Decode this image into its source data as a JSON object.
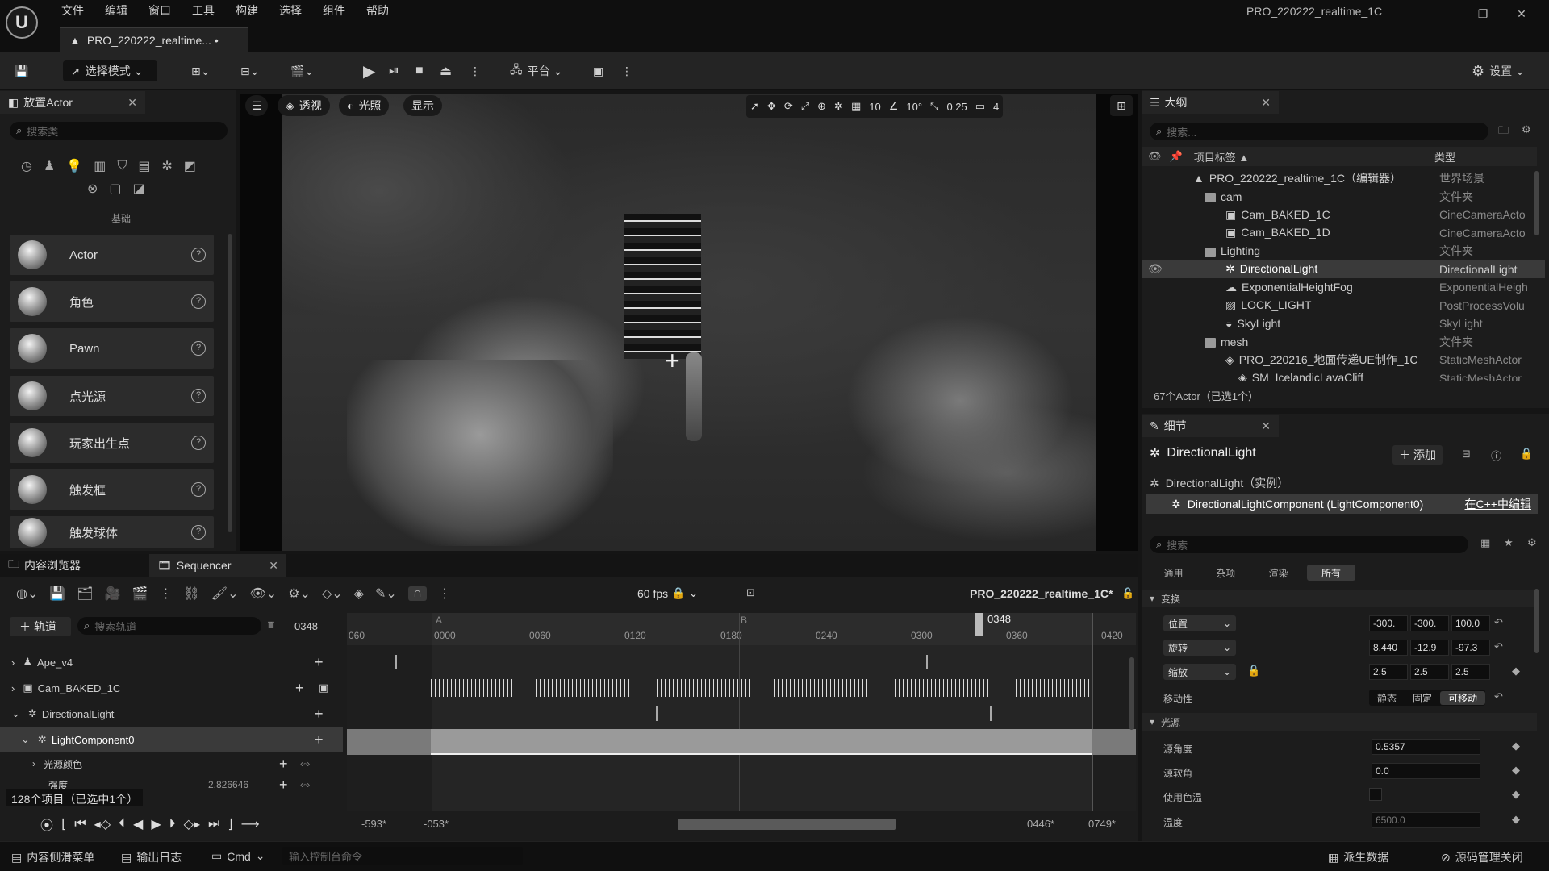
{
  "menu": [
    "文件",
    "编辑",
    "窗口",
    "工具",
    "构建",
    "选择",
    "组件",
    "帮助"
  ],
  "window_title": "PRO_220222_realtime_1C",
  "doc_tab": "PRO_220222_realtime... •",
  "toolbar": {
    "select_mode": "选择模式",
    "platform": "平台",
    "settings": "设置"
  },
  "place_actor": {
    "tab": "放置Actor",
    "search_placeholder": "搜索类",
    "category": "基础",
    "items": [
      "Actor",
      "角色",
      "Pawn",
      "点光源",
      "玩家出生点",
      "触发框",
      "触发球体"
    ]
  },
  "viewport": {
    "perspective": "透视",
    "lighting": "光照",
    "show": "显示",
    "grid": "10",
    "angle": "10°",
    "scale": "0.25",
    "camera": "4"
  },
  "outliner": {
    "tab": "大纲",
    "search_placeholder": "搜索...",
    "col_label": "项目标签 ▲",
    "col_type": "类型",
    "rows": [
      {
        "name": "PRO_220222_realtime_1C（编辑器）",
        "type": "世界场景"
      },
      {
        "name": "cam",
        "type": "文件夹"
      },
      {
        "name": "Cam_BAKED_1C",
        "type": "CineCameraActo"
      },
      {
        "name": "Cam_BAKED_1D",
        "type": "CineCameraActo"
      },
      {
        "name": "Lighting",
        "type": "文件夹"
      },
      {
        "name": "DirectionalLight",
        "type": "DirectionalLight"
      },
      {
        "name": "ExponentialHeightFog",
        "type": "ExponentialHeigh"
      },
      {
        "name": "LOCK_LIGHT",
        "type": "PostProcessVolu"
      },
      {
        "name": "SkyLight",
        "type": "SkyLight"
      },
      {
        "name": "mesh",
        "type": "文件夹"
      },
      {
        "name": "PRO_220216_地面传递UE制作_1C",
        "type": "StaticMeshActor"
      },
      {
        "name": "SM_IcelandicLavaCliff",
        "type": "StaticMeshActor"
      }
    ],
    "count": "67个Actor（已选1个）"
  },
  "details": {
    "tab": "细节",
    "title": "DirectionalLight",
    "add": "添加",
    "instance": "DirectionalLight（实例）",
    "component": "DirectionalLightComponent (LightComponent0)",
    "edit_cpp": "在C++中编辑",
    "search_placeholder": "搜索",
    "filters": [
      "通用",
      "杂项",
      "渲染",
      "所有"
    ],
    "transform": "变换",
    "location": "位置",
    "rotation": "旋转",
    "scale": "缩放",
    "loc": [
      "-300.",
      "-300.",
      "100.0"
    ],
    "rot": [
      "8.440",
      "-12.9",
      "-97.3"
    ],
    "scl": [
      "2.5",
      "2.5",
      "2.5"
    ],
    "mobility": "移动性",
    "mob_opts": [
      "静态",
      "固定",
      "可移动"
    ],
    "light": "光源",
    "source_angle": "源角度",
    "source_angle_val": "0.5357",
    "source_soft": "源软角",
    "source_soft_val": "0.0",
    "use_temp": "使用色温",
    "temp": "温度",
    "temp_val": "6500.0"
  },
  "bottom_tabs": {
    "content": "内容浏览器",
    "sequencer": "Sequencer"
  },
  "sequencer": {
    "fps": "60 fps",
    "seq_name": "PRO_220222_realtime_1C*",
    "add_track": "轨道",
    "search_placeholder": "搜索轨道",
    "frame": "0348",
    "tracks": [
      "Ape_v4",
      "Cam_BAKED_1C",
      "DirectionalLight",
      "LightComponent0",
      "光源颜色",
      "强度"
    ],
    "intensity_val": "2.826646",
    "items_count": "128个项目（已选中1个）",
    "ticks": [
      "060",
      "0000",
      "0060",
      "0120",
      "0180",
      "0240",
      "0300",
      "0360",
      "0420"
    ],
    "marker_a": "A",
    "marker_b": "B",
    "range": [
      "-593*",
      "-053*",
      "0446*",
      "0749*"
    ]
  },
  "status": {
    "content_drawer": "内容侧滑菜单",
    "output_log": "输出日志",
    "cmd": "Cmd",
    "cmd_placeholder": "输入控制台命令",
    "derived": "派生数据",
    "source_control": "源码管理关闭"
  }
}
